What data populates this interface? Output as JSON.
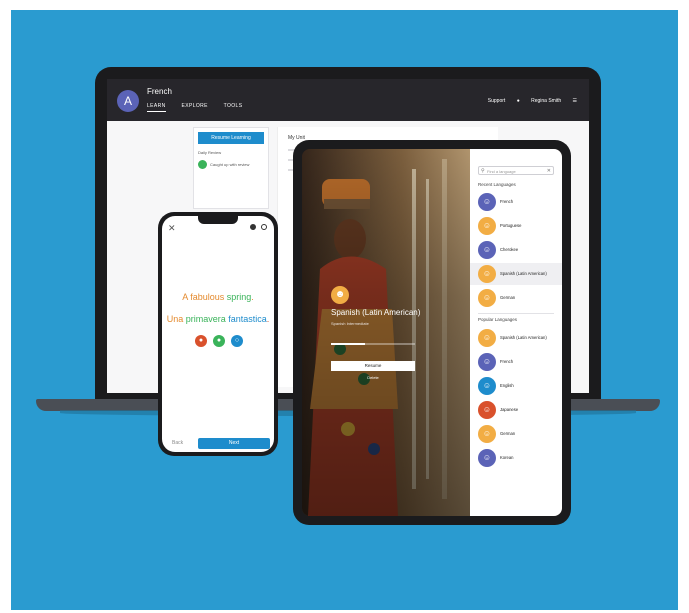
{
  "colors": {
    "background": "#2a9bd0",
    "accent_blue": "#1e8ccc",
    "orange": "#e48a2e",
    "green": "#3ab35a",
    "red": "#d9512c"
  },
  "laptop": {
    "course_title": "French",
    "nav": [
      "LEARN",
      "EXPLORE",
      "TOOLS"
    ],
    "header_right": [
      "Support",
      "Regina Smith"
    ],
    "resume_button": "Resume Learning",
    "daily_review": "Daily Review",
    "caught_up": "Caught up with review",
    "document_title": "My Unit"
  },
  "phone": {
    "english_parts": [
      "A fabulous ",
      "spring",
      "."
    ],
    "french_parts": [
      "Una ",
      "primavera",
      " fantastica",
      "."
    ],
    "back_label": "Back",
    "next_label": "Next"
  },
  "tablet": {
    "current_language": "Spanish (Latin American)",
    "current_language_sub": "Spanish Intermediate",
    "resume_button": "Resume",
    "link_label": "Delete",
    "search_placeholder": "Find a language",
    "recent_heading": "Recent Languages",
    "popular_heading": "Popular Languages",
    "recent_languages": [
      {
        "name": "French",
        "color": "#5b63b7",
        "icon": "person-icon"
      },
      {
        "name": "Portuguese",
        "color": "#f2ad44",
        "icon": "person-icon"
      },
      {
        "name": "Cherokee",
        "color": "#5b63b7",
        "icon": "person-icon"
      },
      {
        "name": "Spanish (Latin American)",
        "color": "#f2ad44",
        "icon": "person-icon",
        "selected": true
      },
      {
        "name": "German",
        "color": "#f2ad44",
        "icon": "person-icon"
      }
    ],
    "popular_languages": [
      {
        "name": "Spanish (Latin American)",
        "color": "#f2ad44",
        "icon": "person-icon"
      },
      {
        "name": "French",
        "color": "#5b63b7",
        "icon": "person-icon"
      },
      {
        "name": "English",
        "color": "#1e8ccc",
        "icon": "person-icon"
      },
      {
        "name": "Japanese",
        "color": "#d9512c",
        "icon": "person-icon"
      },
      {
        "name": "German",
        "color": "#f2ad44",
        "icon": "person-icon"
      },
      {
        "name": "Korean",
        "color": "#5b63b7",
        "icon": "person-icon"
      }
    ]
  }
}
